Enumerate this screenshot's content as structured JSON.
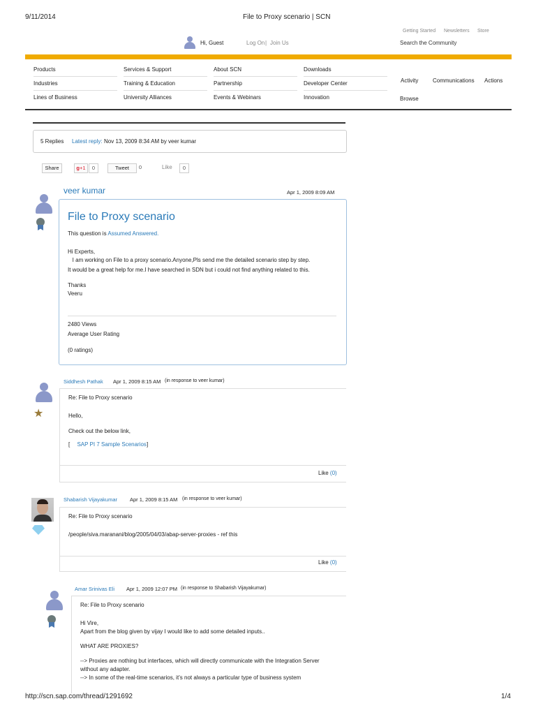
{
  "print_header": {
    "date": "9/11/2014",
    "title": "File to Proxy scenario | SCN"
  },
  "print_footer": {
    "url": "http://scn.sap.com/thread/1291692",
    "page": "1/4"
  },
  "topbar": {
    "greeting": "Hi, Guest",
    "login": "Log On",
    "separator": "|",
    "join": "Join Us",
    "links": [
      "Getting Started",
      "Newsletters",
      "Store"
    ],
    "search_placeholder": "Search the Community"
  },
  "nav": {
    "col1": [
      "Products",
      "Industries",
      "Lines of Business"
    ],
    "col2": [
      "Services & Support",
      "Training & Education",
      "University Alliances"
    ],
    "col3": [
      "About SCN",
      "Partnership",
      "Events & Webinars"
    ],
    "col4": [
      "Downloads",
      "Developer Center",
      "Innovation"
    ],
    "right": [
      "Activity",
      "Communications",
      "Actions"
    ],
    "browse": "Browse"
  },
  "thread_info": {
    "replies": "5 Replies",
    "latest_label": "Latest reply:",
    "latest_value": "Nov 13, 2009 8:34 AM by veer kumar"
  },
  "social": {
    "share": "Share",
    "gplus": "+1",
    "gplus_count": "0",
    "tweet": "Tweet",
    "tweet_count": "0",
    "like": "Like",
    "like_count": "0"
  },
  "question": {
    "author": "veer kumar",
    "date": "Apr 1, 2009 8:09 AM",
    "title": "File to Proxy scenario",
    "status_prefix": "This question is",
    "status": "Assumed Answered.",
    "body": [
      "Hi Experts,",
      "   I am working on File to a proxy scenario.Anyone,Pls send me the detailed scenario step by step.",
      "It would be a great help for me.I have searched in SDN but i could not find anything related to this.",
      "",
      "Thanks",
      "Veeru"
    ],
    "views": "2480 Views",
    "rating_label": "Average User Rating",
    "ratings": "(0 ratings)"
  },
  "replies": [
    {
      "author": "Siddhesh Pathak",
      "date": "Apr 1, 2009 8:15 AM",
      "response": "(in response to veer kumar)",
      "subject": "Re: File to Proxy scenario",
      "body": [
        "Hello,",
        "",
        "Check out the below link,"
      ],
      "link_prefix": "[",
      "link": "SAP PI 7 Sample Scenarios",
      "link_suffix": "]",
      "like": "Like",
      "like_count": "(0)"
    },
    {
      "author": "Shabarish Vijayakumar",
      "date": "Apr 1, 2009 8:15 AM",
      "response": "(in response to veer kumar)",
      "subject": "Re: File to Proxy scenario",
      "body": [
        "/people/siva.maranani/blog/2005/04/03/abap-server-proxies - ref this"
      ],
      "like": "Like",
      "like_count": "(0)"
    },
    {
      "author": "Amar Srinivas Eli",
      "date": "Apr 1, 2009 12:07 PM",
      "response": "(in response to Shabarish Vijayakumar)",
      "subject": "Re: File to Proxy scenario",
      "body": [
        "Hi Vire,",
        "Apart from the blog given by vijay I would like to add some detailed inputs..",
        "",
        "WHAT ARE PROXIES?",
        "",
        "--> Proxies are nothing but interfaces, which will directly communicate with the Integration Server",
        "without any adapter.",
        "--> In some of the real-time scenarios, it’s not always a particular type of business system"
      ]
    }
  ]
}
